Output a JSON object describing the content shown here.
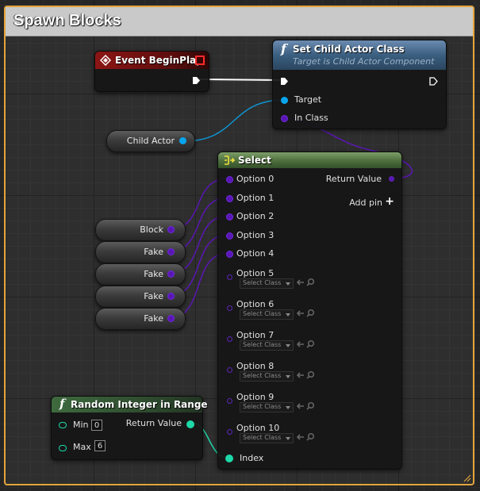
{
  "comment": {
    "title": "Spawn Blocks"
  },
  "event_begin_play": {
    "title": "Event BeginPlay"
  },
  "set_child_actor_class": {
    "function_icon": "f",
    "title": "Set Child Actor Class",
    "subtitle": "Target is Child Actor Component",
    "pins": {
      "target": "Target",
      "in_class": "In Class"
    }
  },
  "child_actor_var": {
    "label": "Child Actor"
  },
  "class_vars": [
    "Block",
    "Fake",
    "Fake",
    "Fake",
    "Fake"
  ],
  "select_node": {
    "title": "Select",
    "connected_options": [
      "Option 0",
      "Option 1",
      "Option 2",
      "Option 3",
      "Option 4"
    ],
    "unconnected_options": [
      "Option 5",
      "Option 6",
      "Option 7",
      "Option 8",
      "Option 9",
      "Option 10"
    ],
    "dropdown_placeholder": "Select Class",
    "return_value": "Return Value",
    "add_pin": "Add pin",
    "index": "Index"
  },
  "random_integer": {
    "function_icon": "f",
    "title": "Random Integer in Range",
    "min_label": "Min",
    "min_value": "0",
    "max_label": "Max",
    "max_value": "6",
    "return_value": "Return Value"
  },
  "colors": {
    "comment_border": "#e3a53b",
    "event_header": "#8c1515",
    "function_header": "#3b5f80",
    "select_header": "#4d6e3c",
    "object_class_pin": "#5a16b4",
    "object_pin": "#08a5ed",
    "integer_pin": "#1ed8a8",
    "exec_wire": "#ffffff"
  },
  "icons": {
    "event": "event-diamond-icon",
    "delegate": "delegate-square-icon",
    "function": "function-f-icon",
    "select": "select-arrow-icon",
    "add_pin": "plus-icon",
    "use_selected": "arrow-left-icon",
    "browse": "magnifier-icon"
  }
}
